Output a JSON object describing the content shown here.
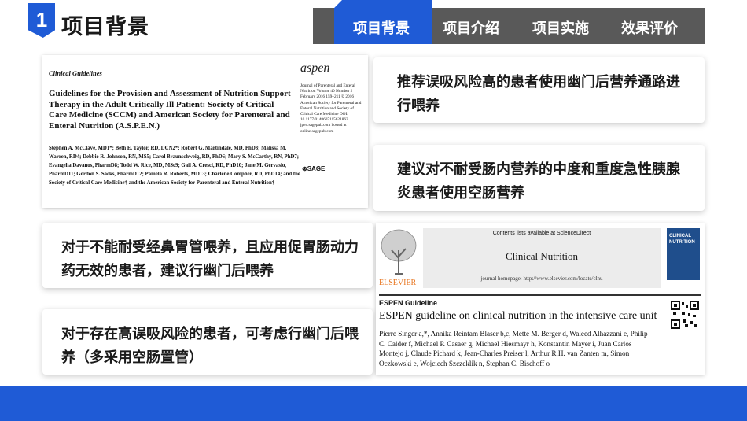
{
  "header": {
    "section_number": "1",
    "title": "项目背景",
    "nav": [
      "项目背景",
      "项目介绍",
      "项目实施",
      "效果评价"
    ]
  },
  "cards": [
    "推荐误吸风险高的患者使用幽门后营养通路进行喂养",
    "建议对不耐受肠内营养的中度和重度急性胰腺炎患者使用空肠营养",
    "对于不能耐受经鼻胃管喂养，且应用促胃肠动力药无效的患者，建议行幽门后喂养",
    "对于存在高误吸风险的患者，可考虑行幽门后喂养（多采用空肠置管）"
  ],
  "paper1": {
    "label": "Clinical Guidelines",
    "title": "Guidelines for the Provision and Assessment of Nutrition Support Therapy in the Adult Critically Ill Patient: Society of Critical Care Medicine (SCCM) and American Society for Parenteral and Enteral Nutrition (A.S.P.E.N.)",
    "authors": "Stephen A. McClave, MD1*; Beth E. Taylor, RD, DCN2*; Robert G. Martindale, MD, PhD3; Malissa M. Warren, RD4; Debbie R. Johnson, RN, MS5; Carol Braunschweig, RD, PhD6; Mary S. McCarthy, RN, PhD7; Evangelia Davanos, PharmD8; Todd W. Rice, MD, MSc9; Gail A. Cresci, RD, PhD10; Jane M. Gervasio, PharmD11; Gordon S. Sacks, PharmD12; Pamela R. Roberts, MD13; Charlene Compher, RD, PhD14; and the Society of Critical Care Medicine† and the American Society for Parenteral and Enteral Nutrition†",
    "logo": "aspen",
    "meta": "Journal of Parenteral and Enteral Nutrition Volume 40 Number 2 February 2016 159–211 © 2016 American Society for Parenteral and Enteral Nutrition and Society of Critical Care Medicine DOI: 10.1177/0148607115621863 jpen.sagepub.com hosted at online.sagepub.com",
    "publisher": "SAGE"
  },
  "paper2": {
    "publisher": "ELSEVIER",
    "availability": "Contents lists available at ScienceDirect",
    "journal": "Clinical Nutrition",
    "homepage": "journal homepage: http://www.elsevier.com/locate/clnu",
    "cover_text": "CLINICAL NUTRITION",
    "label": "ESPEN Guideline",
    "title": "ESPEN guideline on clinical nutrition in the intensive care unit",
    "authors": "Pierre Singer a,*, Annika Reintam Blaser b,c, Mette M. Berger d, Waleed Alhazzani e, Philip C. Calder f, Michael P. Casaer g, Michael Hiesmayr h, Konstantin Mayer i, Juan Carlos Montejo j, Claude Pichard k, Jean-Charles Preiser l, Arthur R.H. van Zanten m, Simon Oczkowski e, Wojciech Szczeklik n, Stephan C. Bischoff o"
  },
  "colors": {
    "accent": "#1f5bd6",
    "nav_bg": "#595959"
  }
}
